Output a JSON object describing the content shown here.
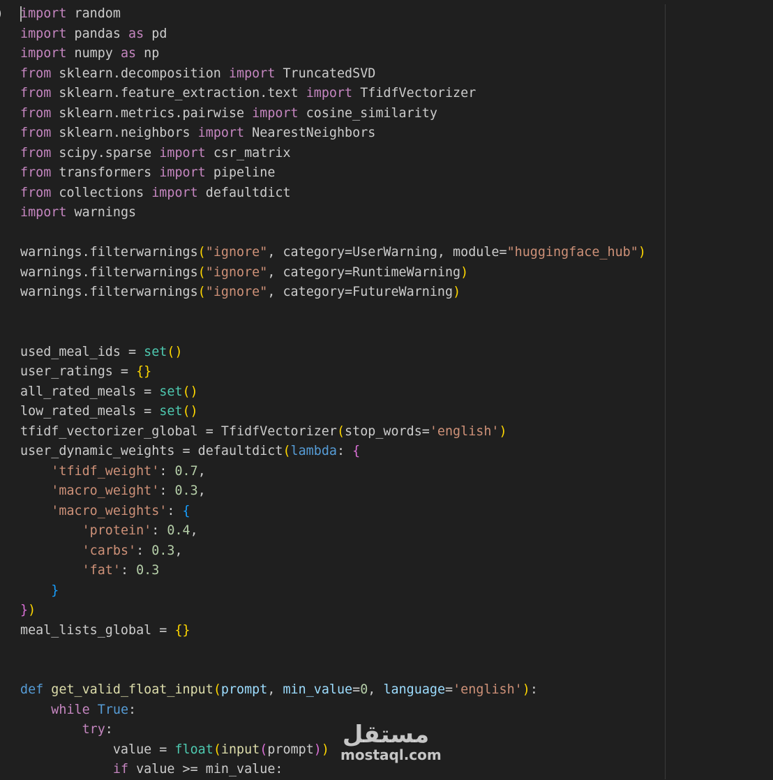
{
  "editor": {
    "language": "python",
    "fold_glyph": ")",
    "colors": {
      "background": "#1f1f1f",
      "keyword_control": "#c586c0",
      "keyword_def": "#569cd6",
      "function": "#dcdcaa",
      "builtin": "#4ec9b0",
      "parameter": "#9cdcfe",
      "string": "#ce9178",
      "number": "#b5cea8",
      "bracket_level1": "#ffd700",
      "bracket_level2": "#da70d6",
      "bracket_level3": "#179fff"
    },
    "lines": [
      [
        [
          "kw",
          "import"
        ],
        [
          "p",
          " random"
        ]
      ],
      [
        [
          "kw",
          "import"
        ],
        [
          "p",
          " pandas "
        ],
        [
          "kw",
          "as"
        ],
        [
          "p",
          " pd"
        ]
      ],
      [
        [
          "kw",
          "import"
        ],
        [
          "p",
          " numpy "
        ],
        [
          "kw",
          "as"
        ],
        [
          "p",
          " np"
        ]
      ],
      [
        [
          "kw",
          "from"
        ],
        [
          "p",
          " sklearn.decomposition "
        ],
        [
          "kw",
          "import"
        ],
        [
          "p",
          " TruncatedSVD"
        ]
      ],
      [
        [
          "kw",
          "from"
        ],
        [
          "p",
          " sklearn.feature_extraction.text "
        ],
        [
          "kw",
          "import"
        ],
        [
          "p",
          " TfidfVectorizer"
        ]
      ],
      [
        [
          "kw",
          "from"
        ],
        [
          "p",
          " sklearn.metrics.pairwise "
        ],
        [
          "kw",
          "import"
        ],
        [
          "p",
          " cosine_similarity"
        ]
      ],
      [
        [
          "kw",
          "from"
        ],
        [
          "p",
          " sklearn.neighbors "
        ],
        [
          "kw",
          "import"
        ],
        [
          "p",
          " NearestNeighbors"
        ]
      ],
      [
        [
          "kw",
          "from"
        ],
        [
          "p",
          " scipy.sparse "
        ],
        [
          "kw",
          "import"
        ],
        [
          "p",
          " csr_matrix"
        ]
      ],
      [
        [
          "kw",
          "from"
        ],
        [
          "p",
          " transformers "
        ],
        [
          "kw",
          "import"
        ],
        [
          "p",
          " pipeline"
        ]
      ],
      [
        [
          "kw",
          "from"
        ],
        [
          "p",
          " collections "
        ],
        [
          "kw",
          "import"
        ],
        [
          "p",
          " defaultdict"
        ]
      ],
      [
        [
          "kw",
          "import"
        ],
        [
          "p",
          " warnings"
        ]
      ],
      [],
      [
        [
          "p",
          "warnings.filterwarnings"
        ],
        [
          "b1",
          "("
        ],
        [
          "str",
          "\"ignore\""
        ],
        [
          "p",
          ", category=UserWarning, module="
        ],
        [
          "str",
          "\"huggingface_hub\""
        ],
        [
          "b1",
          ")"
        ]
      ],
      [
        [
          "p",
          "warnings.filterwarnings"
        ],
        [
          "b1",
          "("
        ],
        [
          "str",
          "\"ignore\""
        ],
        [
          "p",
          ", category=RuntimeWarning"
        ],
        [
          "b1",
          ")"
        ]
      ],
      [
        [
          "p",
          "warnings.filterwarnings"
        ],
        [
          "b1",
          "("
        ],
        [
          "str",
          "\"ignore\""
        ],
        [
          "p",
          ", category=FutureWarning"
        ],
        [
          "b1",
          ")"
        ]
      ],
      [],
      [],
      [
        [
          "p",
          "used_meal_ids = "
        ],
        [
          "bi",
          "set"
        ],
        [
          "b1",
          "()"
        ]
      ],
      [
        [
          "p",
          "user_ratings = "
        ],
        [
          "b1",
          "{}"
        ]
      ],
      [
        [
          "p",
          "all_rated_meals = "
        ],
        [
          "bi",
          "set"
        ],
        [
          "b1",
          "()"
        ]
      ],
      [
        [
          "p",
          "low_rated_meals = "
        ],
        [
          "bi",
          "set"
        ],
        [
          "b1",
          "()"
        ]
      ],
      [
        [
          "p",
          "tfidf_vectorizer_global = TfidfVectorizer"
        ],
        [
          "b1",
          "("
        ],
        [
          "p",
          "stop_words="
        ],
        [
          "str",
          "'english'"
        ],
        [
          "b1",
          ")"
        ]
      ],
      [
        [
          "p",
          "user_dynamic_weights = defaultdict"
        ],
        [
          "b1",
          "("
        ],
        [
          "kwb",
          "lambda"
        ],
        [
          "p",
          ": "
        ],
        [
          "b2",
          "{"
        ]
      ],
      [
        [
          "p",
          "    "
        ],
        [
          "str",
          "'tfidf_weight'"
        ],
        [
          "p",
          ": "
        ],
        [
          "num",
          "0.7"
        ],
        [
          "p",
          ","
        ]
      ],
      [
        [
          "p",
          "    "
        ],
        [
          "str",
          "'macro_weight'"
        ],
        [
          "p",
          ": "
        ],
        [
          "num",
          "0.3"
        ],
        [
          "p",
          ","
        ]
      ],
      [
        [
          "p",
          "    "
        ],
        [
          "str",
          "'macro_weights'"
        ],
        [
          "p",
          ": "
        ],
        [
          "b3",
          "{"
        ]
      ],
      [
        [
          "p",
          "        "
        ],
        [
          "str",
          "'protein'"
        ],
        [
          "p",
          ": "
        ],
        [
          "num",
          "0.4"
        ],
        [
          "p",
          ","
        ]
      ],
      [
        [
          "p",
          "        "
        ],
        [
          "str",
          "'carbs'"
        ],
        [
          "p",
          ": "
        ],
        [
          "num",
          "0.3"
        ],
        [
          "p",
          ","
        ]
      ],
      [
        [
          "p",
          "        "
        ],
        [
          "str",
          "'fat'"
        ],
        [
          "p",
          ": "
        ],
        [
          "num",
          "0.3"
        ]
      ],
      [
        [
          "p",
          "    "
        ],
        [
          "b3",
          "}"
        ]
      ],
      [
        [
          "b2",
          "}"
        ],
        [
          "b1",
          ")"
        ]
      ],
      [
        [
          "p",
          "meal_lists_global = "
        ],
        [
          "b1",
          "{}"
        ]
      ],
      [],
      [],
      [
        [
          "kwb",
          "def"
        ],
        [
          "p",
          " "
        ],
        [
          "fn",
          "get_valid_float_input"
        ],
        [
          "b1",
          "("
        ],
        [
          "param",
          "prompt"
        ],
        [
          "p",
          ", "
        ],
        [
          "param",
          "min_value"
        ],
        [
          "p",
          "="
        ],
        [
          "num",
          "0"
        ],
        [
          "p",
          ", "
        ],
        [
          "param",
          "language"
        ],
        [
          "p",
          "="
        ],
        [
          "str",
          "'english'"
        ],
        [
          "b1",
          ")"
        ],
        [
          "p",
          ":"
        ]
      ],
      [
        [
          "p",
          "    "
        ],
        [
          "kw",
          "while"
        ],
        [
          "p",
          " "
        ],
        [
          "kwb",
          "True"
        ],
        [
          "p",
          ":"
        ]
      ],
      [
        [
          "p",
          "        "
        ],
        [
          "kw",
          "try"
        ],
        [
          "p",
          ":"
        ]
      ],
      [
        [
          "p",
          "            value = "
        ],
        [
          "bi",
          "float"
        ],
        [
          "b1",
          "("
        ],
        [
          "fn",
          "input"
        ],
        [
          "b2",
          "("
        ],
        [
          "p",
          "prompt"
        ],
        [
          "b2",
          ")"
        ],
        [
          "b1",
          ")"
        ]
      ],
      [
        [
          "p",
          "            "
        ],
        [
          "kw",
          "if"
        ],
        [
          "p",
          " value >= min_value:"
        ]
      ]
    ]
  },
  "watermark": {
    "arabic": "مستقل",
    "latin": "mostaql.com"
  }
}
